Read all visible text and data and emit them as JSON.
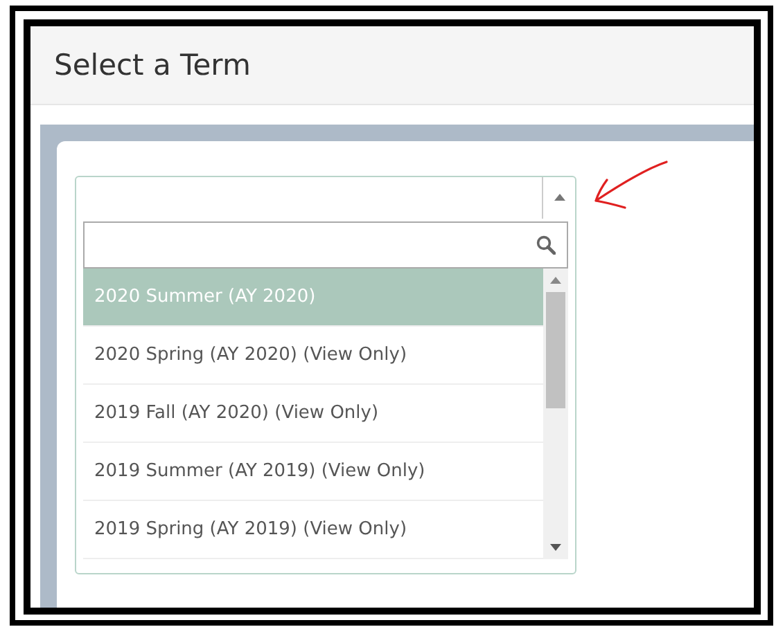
{
  "header": {
    "title": "Select a Term"
  },
  "term_select": {
    "options": [
      {
        "label": "2020 Summer (AY 2020)",
        "selected": true
      },
      {
        "label": "2020 Spring (AY 2020) (View Only)",
        "selected": false
      },
      {
        "label": "2019 Fall (AY 2020) (View Only)",
        "selected": false
      },
      {
        "label": "2019 Summer (AY 2019) (View Only)",
        "selected": false
      },
      {
        "label": "2019 Spring (AY 2019) (View Only)",
        "selected": false
      }
    ]
  }
}
